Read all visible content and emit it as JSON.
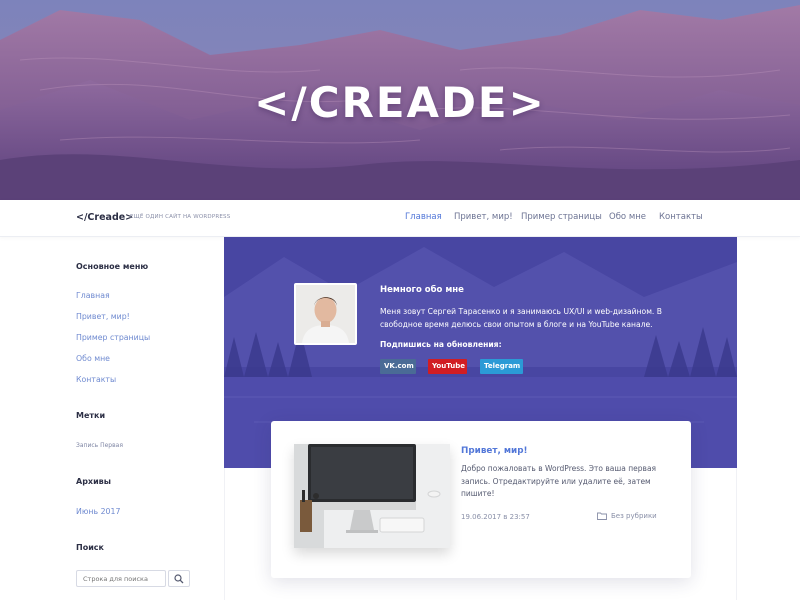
{
  "hero": {
    "title": "</CREADE>"
  },
  "header": {
    "logo": "</Creade>",
    "tagline": "ЕЩЁ ОДИН САЙТ НА WORDPRESS",
    "nav": [
      {
        "label": "Главная",
        "active": true
      },
      {
        "label": "Привет, мир!",
        "active": false
      },
      {
        "label": "Пример страницы",
        "active": false
      },
      {
        "label": "Обо мне",
        "active": false
      },
      {
        "label": "Контакты",
        "active": false
      }
    ]
  },
  "sidebar": {
    "menu_heading": "Основное меню",
    "menu_items": [
      "Главная",
      "Привет, мир!",
      "Пример страницы",
      "Обо мне",
      "Контакты"
    ],
    "tags_heading": "Метки",
    "tags": [
      "Запись Первая"
    ],
    "archives_heading": "Архивы",
    "archives": [
      "Июнь 2017"
    ],
    "search_heading": "Поиск",
    "search_placeholder": "Строка для поиска"
  },
  "about": {
    "title": "Немного обо мне",
    "text": "Меня зовут Сергей Тарасенко и я занимаюсь UX/UI и web-дизайном. В свободное время делюсь свои опытом в блоге и на YouTube канале.",
    "subscribe_label": "Подпишись на обновления:",
    "social": [
      {
        "label": "VK.com",
        "color": "#4a6b96"
      },
      {
        "label": "YouTube",
        "color": "#d11d23"
      },
      {
        "label": "Telegram",
        "color": "#2b9ad6"
      }
    ]
  },
  "post": {
    "title": "Привет, мир!",
    "excerpt": "Добро пожаловать в WordPress. Это ваша первая запись. Отредактируйте или удалите её, затем пишите!",
    "date": "19.06.2017 в 23:57",
    "category": "Без рубрики"
  },
  "colors": {
    "accent": "#5277d8",
    "banner": "#4b49a6",
    "text_dark": "#2c2f45"
  }
}
